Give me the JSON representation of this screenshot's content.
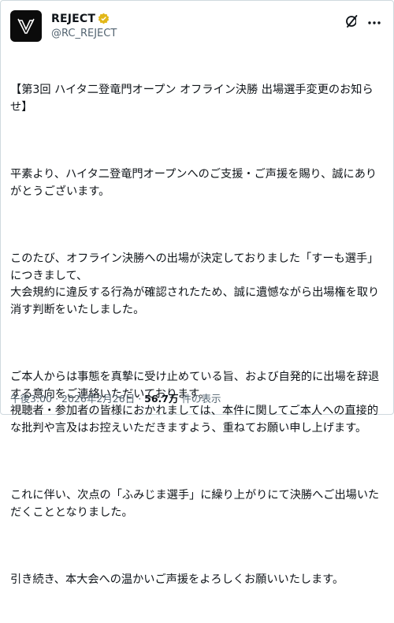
{
  "account": {
    "display_name": "REJECT",
    "handle": "@RC_REJECT",
    "verified": true,
    "verified_color": "#e2b719"
  },
  "post": {
    "paragraphs": [
      "【第3回 ハイタ二登竜門オープン オフライン決勝 出場選手変更のお知らせ】",
      "平素より、ハイタ二登竜門オープンへのご支援・ご声援を賜り、誠にありがとうございます。",
      "このたび、オフライン決勝への出場が決定しておりました「すーも選手」につきまして、\n大会規約に違反する行為が確認されたため、誠に遺憾ながら出場権を取り消す判断をいたしました。",
      "ご本人からは事態を真摯に受け止めている旨、および自発的に出場を辞退する意向をご連絡いただいております。\n視聴者・参加者の皆様におかれましては、本件に関してご本人への直接的な批判や言及はお控えいただきますよう、重ねてお願い申し上げます。",
      "これに伴い、次点の「ふみじま選手」に繰り上がりにて決勝へご出場いただくこととなりました。",
      "引き続き、本大会への温かいご声援をよろしくお願いいたします。"
    ]
  },
  "meta": {
    "time": "午後3:00",
    "date": "2026年2月26日",
    "views_count": "56.7万",
    "views_label": "件の表示",
    "separator": "·"
  },
  "icons": {
    "avatar_logo": "reject-logo-icon",
    "verified": "verified-badge-icon",
    "grok": "grok-icon",
    "more": "more-dots-icon"
  }
}
